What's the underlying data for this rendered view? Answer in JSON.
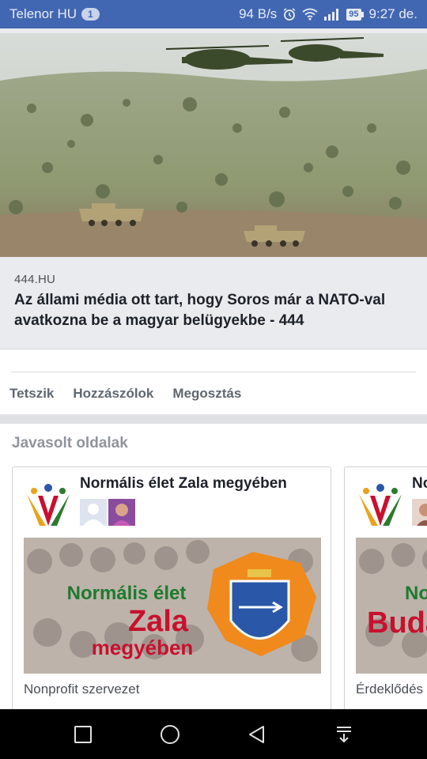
{
  "status_bar": {
    "carrier": "Telenor HU",
    "notification_count": "1",
    "network_speed": "94 B/s",
    "battery": "95",
    "time": "9:27 de.",
    "icons": [
      "alarm-icon",
      "wifi-icon",
      "signal-icon",
      "battery-icon"
    ]
  },
  "link_preview": {
    "domain": "444.HU",
    "title": "Az állami média ott tart, hogy Soros már a NATO-val avatkozna be a magyar belügyekbe - 444"
  },
  "actions": {
    "like": "Tetszik",
    "comment": "Hozzászólok",
    "share": "Megosztás"
  },
  "suggested_pages": {
    "heading": "Javasolt oldalak",
    "cards": [
      {
        "name": "Normális élet Zala megyében",
        "cover_text": [
          "Normális élet",
          "Zala",
          "megyében"
        ],
        "category": "Nonprofit szervezet"
      },
      {
        "name": "No",
        "cover_text": [
          "No",
          "Buda"
        ],
        "category": "Érdeklődés"
      }
    ]
  },
  "nav_bar": {
    "icons": [
      "recents-square-icon",
      "home-circle-icon",
      "back-triangle-icon",
      "notification-pull-down-icon"
    ]
  },
  "colors": {
    "facebook_blue": "#4267b2",
    "cover_green": "#1e7a2e",
    "cover_red": "#c8102e",
    "shield_orange": "#f08a1c"
  }
}
